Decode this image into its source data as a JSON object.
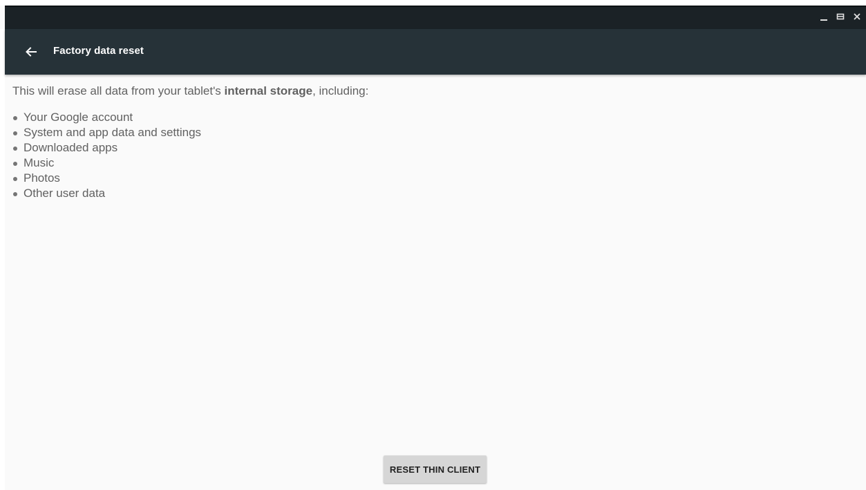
{
  "window": {
    "controls": [
      "minimize-icon",
      "maximize-icon",
      "close-icon"
    ]
  },
  "app_bar": {
    "back_icon": "arrow-left-icon",
    "title": "Factory data reset",
    "color": "#263238"
  },
  "content": {
    "intro_before": "This will erase all data from your tablet's ",
    "intro_bold": "internal storage",
    "intro_after": ", including:",
    "items": [
      "Your Google account",
      "System and app data and settings",
      "Downloaded apps",
      "Music",
      "Photos",
      "Other user data"
    ]
  },
  "actions": {
    "reset_label": "RESET THIN CLIENT"
  }
}
